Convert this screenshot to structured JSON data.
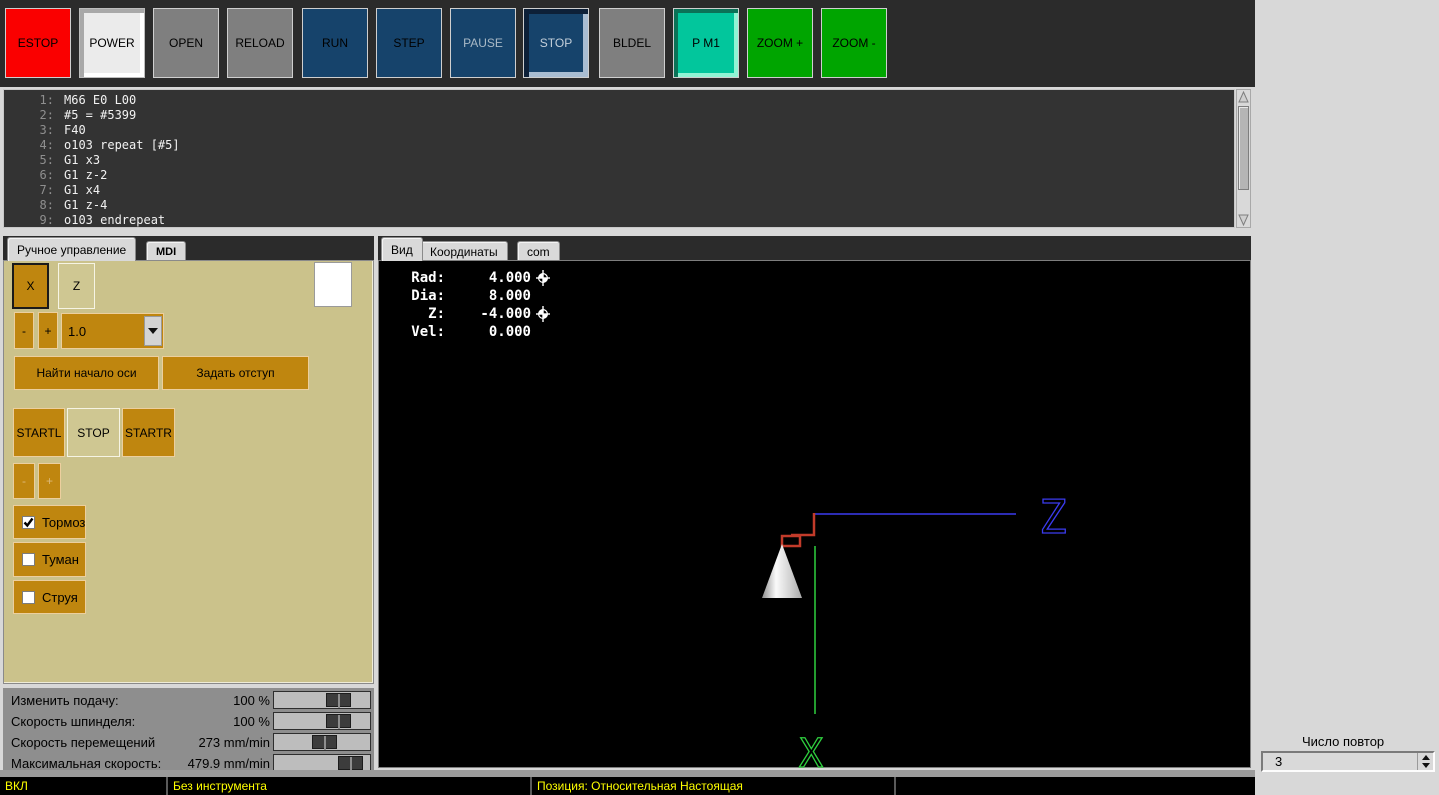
{
  "toolbar": {
    "buttons": [
      "ESTOP",
      "POWER",
      "OPEN",
      "RELOAD",
      "RUN",
      "STEP",
      "PAUSE",
      "STOP",
      "BLDEL",
      "P M1",
      "ZOOM +",
      "ZOOM -"
    ]
  },
  "gcode": {
    "lines": [
      {
        "num": "1:",
        "code": "M66 E0 L00"
      },
      {
        "num": "2:",
        "code": "#5 = #5399"
      },
      {
        "num": "3:",
        "code": "F40"
      },
      {
        "num": "4:",
        "code": "o103 repeat [#5]"
      },
      {
        "num": "5:",
        "code": "G1 x3"
      },
      {
        "num": "6:",
        "code": "G1 z-2"
      },
      {
        "num": "7:",
        "code": "G1 x4"
      },
      {
        "num": "8:",
        "code": "G1 z-4"
      },
      {
        "num": "9:",
        "code": "o103 endrepeat"
      }
    ]
  },
  "left_panel": {
    "tabs": [
      {
        "label": "Ручное управление"
      },
      {
        "label": "MDI"
      }
    ],
    "axis_buttons": [
      {
        "label": "X"
      },
      {
        "label": "Z"
      }
    ],
    "jog_minus": "-",
    "jog_plus": "+",
    "increment": "1.0",
    "home_button": "Найти начало оси",
    "offset_button": "Задать отступ",
    "spindle_buttons": [
      {
        "label": "STARTL"
      },
      {
        "label": "STOP"
      },
      {
        "label": "STARTR"
      }
    ],
    "spindle_minus": "-",
    "spindle_plus": "+",
    "checkboxes": [
      {
        "label": "Тормоз",
        "checked": true
      },
      {
        "label": "Туман",
        "checked": false
      },
      {
        "label": "Струя",
        "checked": false
      }
    ]
  },
  "overrides": {
    "rows": [
      {
        "label": "Изменить подачу:",
        "value": "100 %"
      },
      {
        "label": "Скорость шпинделя:",
        "value": "100 %"
      },
      {
        "label": "Скорость перемещений",
        "value": "273 mm/min"
      },
      {
        "label": "Максимальная скорость:",
        "value": "479.9 mm/min"
      }
    ]
  },
  "right_panel": {
    "tabs": [
      {
        "label": "Вид"
      },
      {
        "label": "Координаты"
      },
      {
        "label": "com"
      }
    ],
    "dro": {
      "rows": [
        {
          "label": "Rad:",
          "value": "4.000",
          "homed": true
        },
        {
          "label": "Dia:",
          "value": "8.000",
          "homed": false
        },
        {
          "label": "Z:",
          "value": "-4.000",
          "homed": true
        },
        {
          "label": "Vel:",
          "value": "0.000",
          "homed": false
        }
      ]
    },
    "axis_labels": {
      "z": "Z",
      "x": "X"
    }
  },
  "repeat_box": {
    "label": "Число повтор",
    "value": "3"
  },
  "statusbar": {
    "machine_state": "ВКЛ",
    "tool": "Без инструмента",
    "position": "Позиция: Относительная Настоящая"
  },
  "colors": {
    "estop_red": "#fa0000",
    "run_navy": "#16436b",
    "pm1_teal": "#02c69c",
    "zoom_green": "#00a500",
    "button_orange": "#bf860f",
    "panel_khaki": "#cbc28b",
    "status_yellow": "#ffff00",
    "path_red": "#c23b2a",
    "axis_blue": "#3b3bf0",
    "axis_green": "#2fcf3f"
  }
}
